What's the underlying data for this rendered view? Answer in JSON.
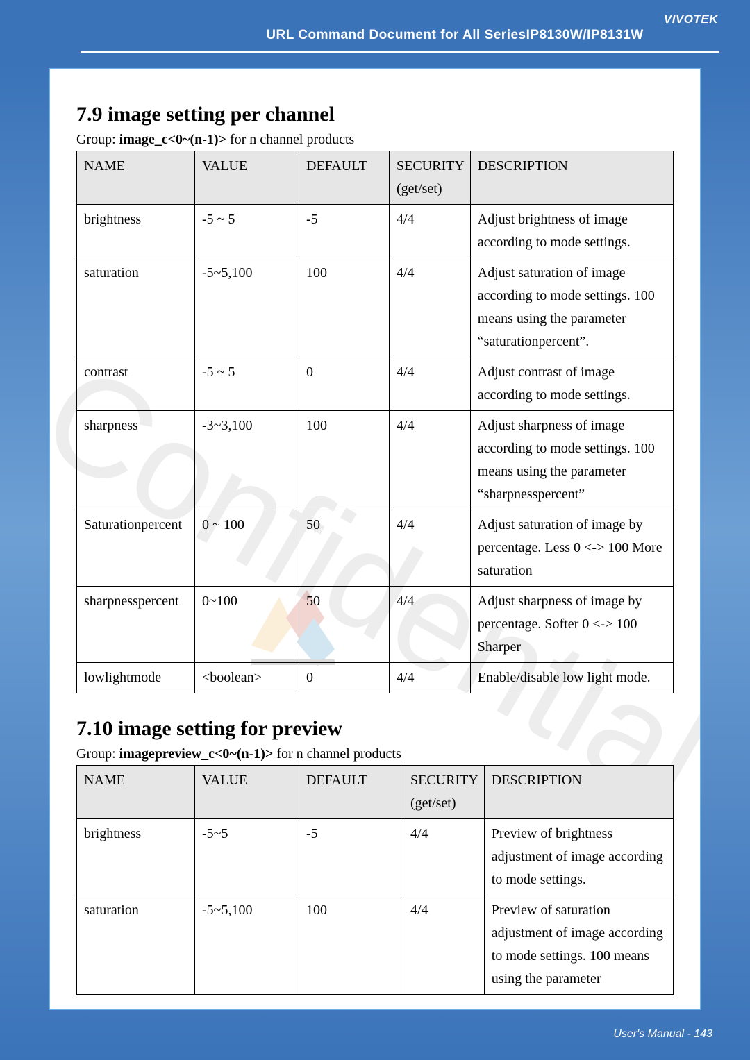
{
  "header": {
    "brand": "VIVOTEK",
    "doc_title": "URL Command Document for All SeriesIP8130W/IP8131W"
  },
  "watermark_text": "Confidential",
  "section79": {
    "heading": "7.9 image setting per channel",
    "group_prefix": "Group: ",
    "group_bold": "image_c<0~(n-1)>",
    "group_suffix": " for n channel products",
    "cols": {
      "name": "NAME",
      "value": "VALUE",
      "default": "DEFAULT",
      "security_l1": "SECURITY",
      "security_l2": "(get/set)",
      "description": "DESCRIPTION"
    },
    "rows": [
      {
        "name": "brightness",
        "value": "-5 ~ 5",
        "default": "-5",
        "security": "4/4",
        "description": "Adjust brightness of image according to mode settings."
      },
      {
        "name": "saturation",
        "value": "-5~5,100",
        "default": "100",
        "security": "4/4",
        "description": "Adjust saturation of image according to mode settings. 100 means using the parameter “saturationpercent”."
      },
      {
        "name": "contrast",
        "value": "-5 ~ 5",
        "default": "0",
        "security": "4/4",
        "description": "Adjust contrast of image according to mode settings."
      },
      {
        "name": "sharpness",
        "value": "-3~3,100",
        "default": "100",
        "security": "4/4",
        "description": "Adjust sharpness of image according to mode settings. 100 means using the parameter “sharpnesspercent”"
      },
      {
        "name": "Saturationpercent",
        "value": "0 ~ 100",
        "default": "50",
        "security": "4/4",
        "description": "Adjust saturation of image by percentage. Less 0 <-> 100 More saturation"
      },
      {
        "name": "sharpnesspercent",
        "value": "0~100",
        "default": "50",
        "security": "4/4",
        "description": "Adjust sharpness of image by percentage. Softer 0 <-> 100 Sharper"
      },
      {
        "name": "lowlightmode",
        "value": "<boolean>",
        "default": "0",
        "security": "4/4",
        "description": "Enable/disable low light mode."
      }
    ]
  },
  "section710": {
    "heading": "7.10 image setting for preview",
    "group_prefix": "Group: ",
    "group_bold": "imagepreview_c<0~(n-1)>",
    "group_suffix": " for n channel products",
    "cols": {
      "name": "NAME",
      "value": "VALUE",
      "default": "DEFAULT",
      "security_l1": "SECURITY",
      "security_l2": "(get/set)",
      "description": "DESCRIPTION"
    },
    "rows": [
      {
        "name": "brightness",
        "value": "-5~5",
        "default": "-5",
        "security": "4/4",
        "description": "Preview of brightness adjustment of image according to mode settings."
      },
      {
        "name": "saturation",
        "value": "-5~5,100",
        "default": "100",
        "security": "4/4",
        "description": "Preview of saturation adjustment of image according to mode settings. 100 means using the parameter"
      }
    ]
  },
  "footer": {
    "text": "User's Manual - 143"
  }
}
